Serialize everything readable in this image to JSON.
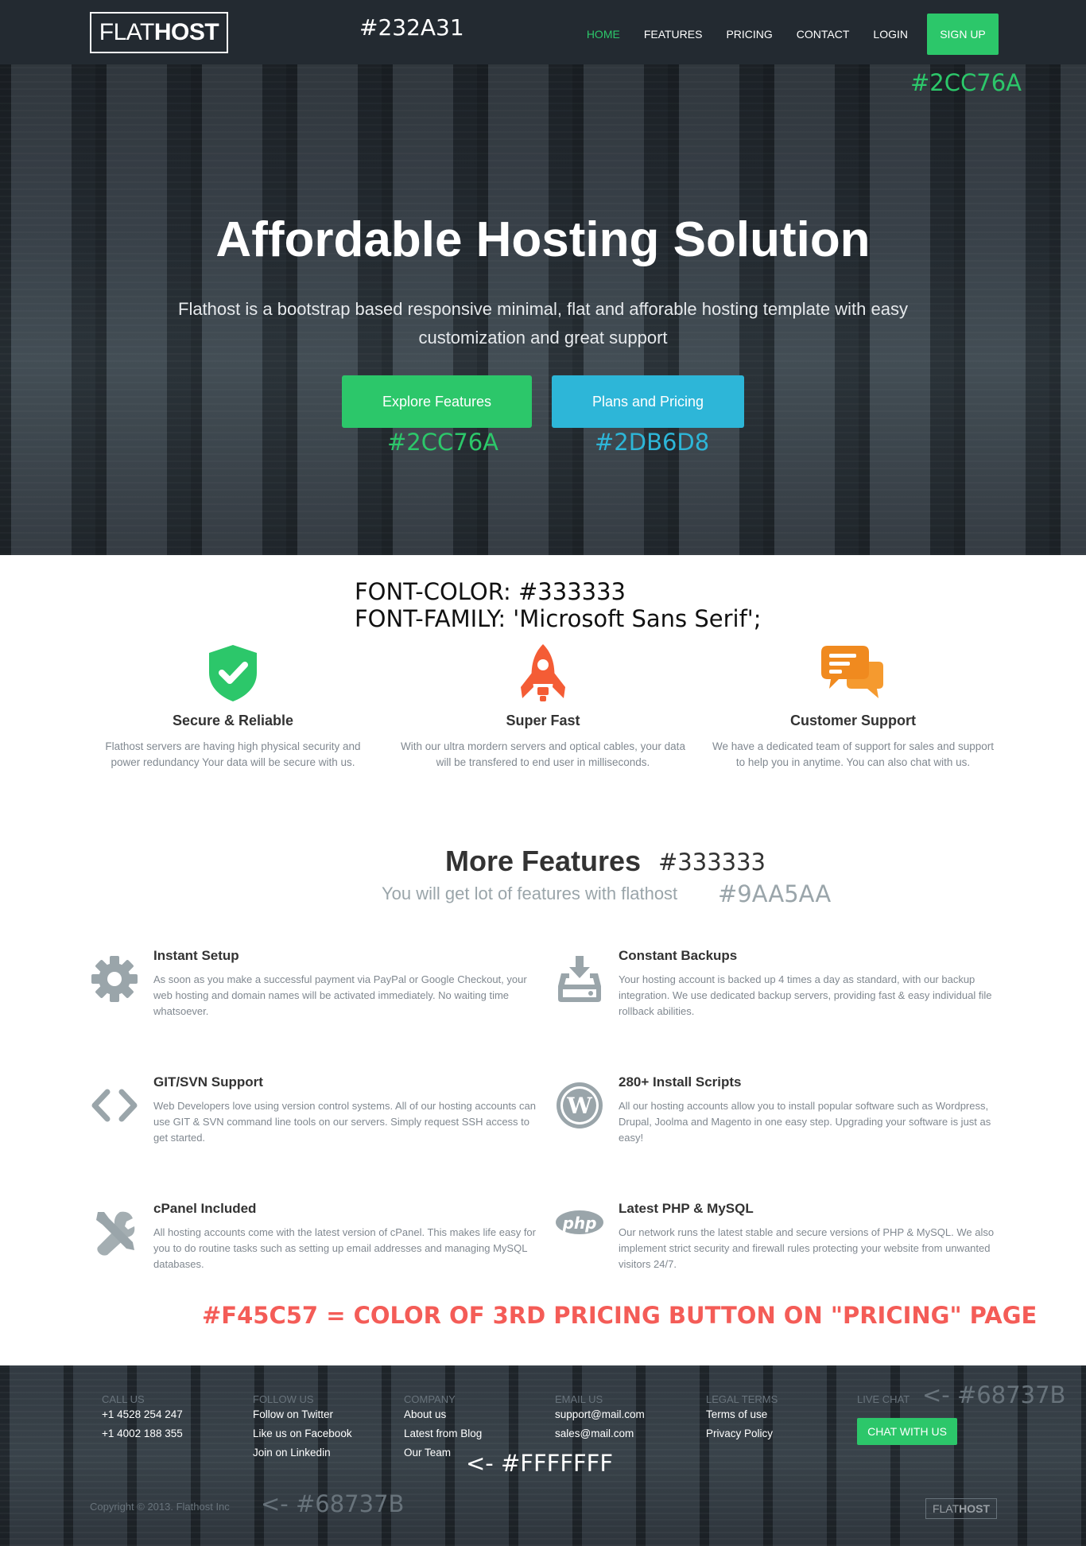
{
  "nav": {
    "logo_light": "FLAT",
    "logo_bold": "HOST",
    "links": [
      {
        "label": "HOME",
        "active": true
      },
      {
        "label": "FEATURES"
      },
      {
        "label": "PRICING"
      },
      {
        "label": "CONTACT"
      },
      {
        "label": "LOGIN"
      }
    ],
    "signup": "SIGN UP"
  },
  "annotations": {
    "nav_color": "#232A31",
    "signup_color": "#2CC76A",
    "explore_color": "#2CC76A",
    "pricing_color": "#2DB6D8",
    "font_color": "FONT-COLOR: #333333",
    "font_family": "FONT-FAMILY: 'Microsoft Sans Serif';",
    "title_color": "#333333",
    "subtitle_color": "#9AA5AA",
    "pricing_note": "#F45C57 = COLOR OF 3RD PRICING BUTTON ON \"PRICING\" PAGE",
    "live_chat_note": "<- #68737B",
    "white_note": "<- #FFFFFFF",
    "copyright_note": "<- #68737B"
  },
  "hero": {
    "title": "Affordable Hosting Solution",
    "subtitle": "Flathost is a bootstrap based responsive minimal, flat and afforable hosting template with easy customization and great support",
    "btn_explore": "Explore Features",
    "btn_pricing": "Plans and Pricing"
  },
  "trio": [
    {
      "icon": "shield-check-icon",
      "title": "Secure & Reliable",
      "text": "Flathost servers are having high physical security and power redundancy Your data will be secure with us."
    },
    {
      "icon": "rocket-icon",
      "title": "Super Fast",
      "text": "With our ultra mordern servers and optical cables, your data will be transfered to end user in milliseconds."
    },
    {
      "icon": "chat-bubbles-icon",
      "title": "Customer Support",
      "text": "We have a dedicated team of support for sales and support to help you in anytime. You can also chat with us."
    }
  ],
  "more_features": {
    "title": "More Features",
    "subtitle": "You will get lot of features with flathost",
    "items": [
      {
        "icon": "gear-icon",
        "title": "Instant Setup",
        "text": "As soon as you make a successful payment via PayPal or Google Checkout, your web hosting and domain names will be activated immediately. No waiting time whatsoever."
      },
      {
        "icon": "backup-drive-icon",
        "title": "Constant Backups",
        "text": "Your hosting account is backed up 4 times a day as standard, with our backup integration. We use dedicated backup servers, providing fast & easy individual file rollback abilities."
      },
      {
        "icon": "code-icon",
        "title": "GIT/SVN Support",
        "text": "Web Developers love using version control systems. All of our hosting accounts can use GIT & SVN command line tools on our servers. Simply request SSH access to get started."
      },
      {
        "icon": "wordpress-icon",
        "title": "280+ Install Scripts",
        "text": "All our hosting accounts allow you to install popular software such as Wordpress, Drupal, Joolma and Magento in one easy step. Upgrading your software is just as easy!"
      },
      {
        "icon": "tools-icon",
        "title": "cPanel Included",
        "text": "All hosting accounts come with the latest version of cPanel. This makes life easy for you to do routine tasks such as setting up email addresses and managing MySQL databases."
      },
      {
        "icon": "php-icon",
        "title": "Latest PHP & MySQL",
        "text": "Our network runs the latest stable and secure versions of PHP & MySQL. We also implement strict security and firewall rules protecting your website from unwanted visitors 24/7."
      }
    ]
  },
  "footer": {
    "cols": [
      {
        "heading": "CALL US",
        "links": [
          "+1 4528 254 247",
          "+1 4002 188 355"
        ]
      },
      {
        "heading": "FOLLOW US",
        "links": [
          "Follow on Twitter",
          "Like us on Facebook",
          "Join on Linkedin"
        ]
      },
      {
        "heading": "COMPANY",
        "links": [
          "About us",
          "Latest from Blog",
          "Our Team"
        ]
      },
      {
        "heading": "EMAIL US",
        "links": [
          "support@mail.com",
          "sales@mail.com"
        ]
      },
      {
        "heading": "LEGAL TERMS",
        "links": [
          "Terms of use",
          "Privacy Policy"
        ]
      },
      {
        "heading": "LIVE CHAT",
        "links": []
      }
    ],
    "chat_button": "CHAT WITH US",
    "copyright": "Copyright © 2013. Flathost Inc",
    "logo_light": "FLAT",
    "logo_bold": "HOST"
  },
  "colors": {
    "nav_bg": "#232A31",
    "green": "#2CC76A",
    "blue": "#2DB6D8",
    "text": "#333333",
    "muted": "#9AA5AA",
    "footer_text": "#68737B",
    "red": "#F45C57"
  }
}
